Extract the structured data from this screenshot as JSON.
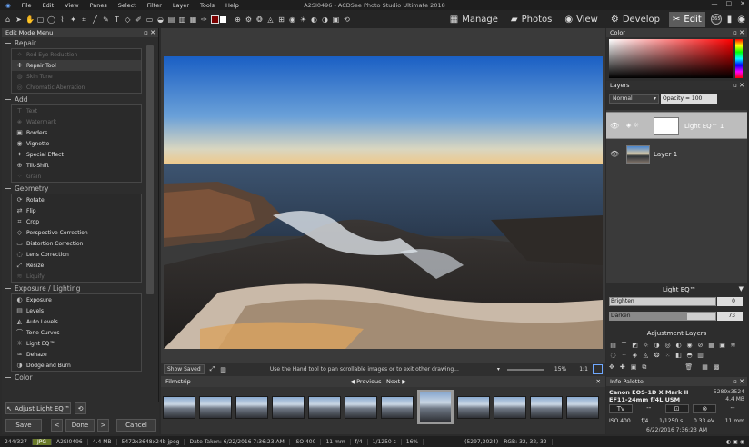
{
  "app": {
    "title": "A2SI0496 - ACDSee Photo Studio Ultimate 2018"
  },
  "menu": [
    "File",
    "Edit",
    "View",
    "Panes",
    "Select",
    "Filter",
    "Layer",
    "Tools",
    "Help"
  ],
  "modes": [
    {
      "label": "Manage",
      "icon": "manage-icon"
    },
    {
      "label": "Photos",
      "icon": "photos-icon"
    },
    {
      "label": "View",
      "icon": "view-icon"
    },
    {
      "label": "Develop",
      "icon": "develop-icon"
    },
    {
      "label": "Edit",
      "icon": "edit-icon",
      "active": true
    }
  ],
  "mode_badge": "365",
  "left_panel": {
    "title": "Edit Mode Menu",
    "sections": [
      {
        "title": "Repair",
        "items": [
          {
            "label": "Red Eye Reduction",
            "disabled": true
          },
          {
            "label": "Repair Tool",
            "selected": true
          },
          {
            "label": "Skin Tune",
            "disabled": true
          },
          {
            "label": "Chromatic Aberration",
            "disabled": true
          }
        ]
      },
      {
        "title": "Add",
        "items": [
          {
            "label": "Text",
            "disabled": true
          },
          {
            "label": "Watermark",
            "disabled": true
          },
          {
            "label": "Borders"
          },
          {
            "label": "Vignette"
          },
          {
            "label": "Special Effect"
          },
          {
            "label": "Tilt-Shift"
          },
          {
            "label": "Grain",
            "disabled": true
          }
        ]
      },
      {
        "title": "Geometry",
        "items": [
          {
            "label": "Rotate"
          },
          {
            "label": "Flip"
          },
          {
            "label": "Crop"
          },
          {
            "label": "Perspective Correction"
          },
          {
            "label": "Distortion Correction"
          },
          {
            "label": "Lens Correction"
          },
          {
            "label": "Resize"
          },
          {
            "label": "Liquify",
            "disabled": true
          }
        ]
      },
      {
        "title": "Exposure / Lighting",
        "items": [
          {
            "label": "Exposure"
          },
          {
            "label": "Levels"
          },
          {
            "label": "Auto Levels"
          },
          {
            "label": "Tone Curves"
          },
          {
            "label": "Light EQ™"
          },
          {
            "label": "Dehaze"
          },
          {
            "label": "Dodge and Burn"
          }
        ]
      },
      {
        "title": "Color",
        "items": []
      }
    ],
    "adjust_button": "Adjust Light EQ™",
    "save": "Save",
    "done": "Done",
    "cancel": "Cancel"
  },
  "image_status": {
    "show_saved": "Show Saved",
    "hint": "Use the Hand tool to pan scrollable images or to exit other drawing...",
    "zoom": "15%",
    "ratio": "1:1"
  },
  "filmstrip": {
    "title": "Filmstrip",
    "previous": "Previous",
    "next": "Next"
  },
  "color_panel": {
    "title": "Color"
  },
  "layers_panel": {
    "title": "Layers",
    "blend_mode": "Normal",
    "opacity": "Opacity = 100",
    "layers": [
      {
        "name": "Light EQ™ 1"
      },
      {
        "name": "Layer 1"
      }
    ],
    "adjustment_title": "Light EQ™",
    "brighten_label": "Brighten",
    "brighten_value": "0",
    "brighten_fraction": 0,
    "darken_label": "Darken",
    "darken_value": "73",
    "darken_fraction": 0.73
  },
  "adjustment_layers": {
    "title": "Adjustment Layers"
  },
  "info_panel": {
    "title": "Info Palette",
    "camera": "Canon EOS-1D X Mark II",
    "dimensions": "5289x3524",
    "lens": "EF11-24mm f/4L USM",
    "size": "4.4 MB",
    "modes": [
      "Tv",
      "--",
      "",
      "⊗",
      "--"
    ],
    "iso": "ISO 400",
    "aperture": "f/4",
    "shutter": "1/1250 s",
    "ev": "0.33 eV",
    "focal": "11 mm",
    "date": "6/22/2016 7:36:23 AM"
  },
  "statusbar": [
    "244/327",
    "JPG",
    "A2SI0496",
    "4.4 MB",
    "5472x3648x24b jpeg",
    "Date Taken: 6/22/2016 7:36:23 AM",
    "ISO 400",
    "11 mm",
    "f/4",
    "1/1250 s",
    "16%",
    "(5297,3024) - RGB: 32, 32, 32"
  ]
}
